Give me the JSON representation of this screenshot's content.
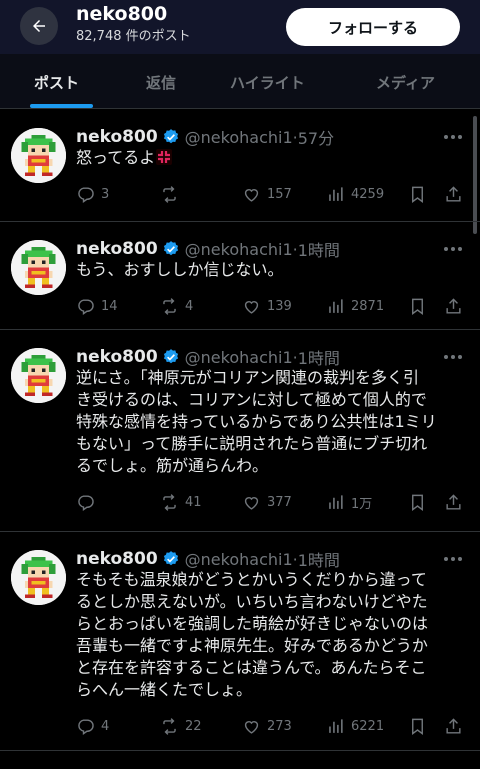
{
  "header": {
    "name": "neko800",
    "post_count": "82,748 件のポスト",
    "follow_label": "フォローする"
  },
  "tabs": [
    "ポスト",
    "返信",
    "ハイライト",
    "メディア"
  ],
  "active_tab": 0,
  "colors": {
    "accent": "#1d9bf0",
    "verified": "#1d9bf0",
    "muted": "#71767b",
    "header_bg": "#12152a"
  },
  "posts": [
    {
      "name": "neko800",
      "handle": "@nekohachi1",
      "time": "57分",
      "lines": [
        "怒ってるよ"
      ],
      "emoji": "anger-symbol",
      "replies": "3",
      "reposts": "",
      "likes": "157",
      "views": "4259"
    },
    {
      "name": "neko800",
      "handle": "@nekohachi1",
      "time": "1時間",
      "lines": [
        "もう、おすししか信じない。"
      ],
      "replies": "14",
      "reposts": "4",
      "likes": "139",
      "views": "2871"
    },
    {
      "name": "neko800",
      "handle": "@nekohachi1",
      "time": "1時間",
      "lines": [
        "逆にさ。「神原元がコリアン関連の裁判を多く引",
        "き受けるのは、コリアンに対して極めて個人的で",
        "特殊な感情を持っているからであり公共性は1ミリ",
        "もない」って勝手に説明されたら普通にブチ切れ",
        "るでしょ。筋が通らんわ。"
      ],
      "replies": "",
      "reposts": "41",
      "likes": "377",
      "views": "1万"
    },
    {
      "name": "neko800",
      "handle": "@nekohachi1",
      "time": "1時間",
      "lines": [
        "そもそも温泉娘がどうとかいうくだりから違って",
        "るとしか思えないが。いちいち言わないけどやた",
        "らとおっぱいを強調した萌絵が好きじゃないのは",
        "吾輩も一緒ですよ神原先生。好みであるかどうか",
        "と存在を許容することは違うんで。あんたらそこ",
        "らへん一緒くたでしょ。"
      ],
      "replies": "4",
      "reposts": "22",
      "likes": "273",
      "views": "6221"
    }
  ]
}
